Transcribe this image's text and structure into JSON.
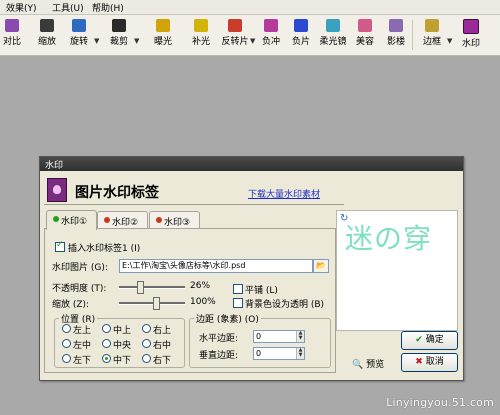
{
  "menu": {
    "items": [
      "效果(Y)",
      "工具(U)",
      "帮助(H)"
    ]
  },
  "toolbar": {
    "items": [
      {
        "label": "对比",
        "color": "#8a4ab0"
      },
      {
        "label": "缩放",
        "color": "#3a3a3a"
      },
      {
        "label": "旋转",
        "color": "#2e6bc0"
      },
      {
        "label": "裁剪",
        "color": "#2a2a2a"
      },
      {
        "label": "曝光",
        "color": "#d1a50a"
      },
      {
        "label": "补光",
        "color": "#d1b30a"
      },
      {
        "label": "反转片",
        "color": "#c93c2a"
      },
      {
        "label": "负冲",
        "color": "#b53a9e"
      },
      {
        "label": "负片",
        "color": "#2b4ad0"
      },
      {
        "label": "柔光镜",
        "color": "#3aa0c0"
      },
      {
        "label": "美容",
        "color": "#d05a8a"
      },
      {
        "label": "影楼",
        "color": "#8a6ab0"
      },
      {
        "label": "边框",
        "color": "#c0a030"
      },
      {
        "label": "水印",
        "color": "#9a2a9a"
      }
    ]
  },
  "dialog": {
    "title": "水印",
    "header_title": "图片水印标签",
    "download_link": "下载大量水印素材",
    "tabs": [
      {
        "label": "水印①",
        "color": "#21a121"
      },
      {
        "label": "水印②",
        "color": "#c83a1a"
      },
      {
        "label": "水印③",
        "color": "#c83a1a"
      }
    ],
    "insert_label": "插入水印标签1 (I)",
    "image_label": "水印图片 (G):",
    "image_path": "E:\\工作\\淘宝\\头像店标等\\水印.psd",
    "opacity_label": "不透明度 (T):",
    "opacity_value": "26%",
    "opacity_level": 0.26,
    "scale_label": "缩放 (Z):",
    "scale_value": "100%",
    "scale_level": 0.5,
    "tile_label": "平铺 (L)",
    "bg_transparent_label": "背景色设为透明 (B)",
    "position_group": "位置 (R)",
    "positions": [
      "左上",
      "中上",
      "右上",
      "左中",
      "中央",
      "右中",
      "左下",
      "中下",
      "右下"
    ],
    "selected_position": "中下",
    "margin_group": "边距 (象素) (O)",
    "h_margin_label": "水平边距:",
    "h_margin_value": "0",
    "v_margin_label": "垂直边距:",
    "v_margin_value": "0",
    "preview_label": "预览",
    "ok_label": "确定",
    "cancel_label": "取消",
    "preview_watermark_text": "迷の穿"
  },
  "site_watermark": "Linyingyou.51.com"
}
